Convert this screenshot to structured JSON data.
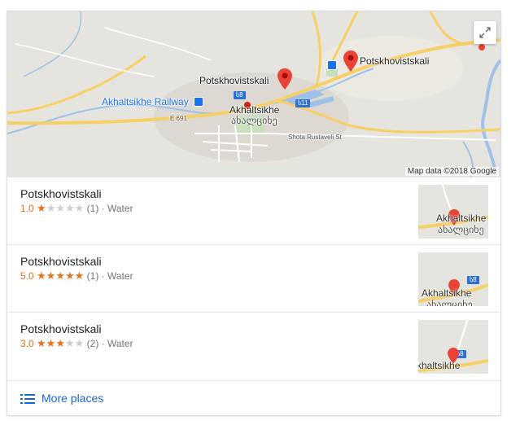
{
  "map": {
    "labels": {
      "pin1": "Potskhovistskali",
      "pin2": "Potskhovistskali",
      "railway": "Akhaltsikhe Railway",
      "town": "Akhaltsikhe",
      "town_script": "ახალციხე",
      "road_e691": "E 691",
      "road_shota": "Shota Rustaveli St",
      "shield_8": "ს8",
      "shield_11": "ს11"
    },
    "attribution": "Map data ©2018 Google",
    "expand_icon": "expand-icon"
  },
  "results": [
    {
      "name": "Potskhovistskali",
      "rating": "1.0",
      "stars_filled": 1,
      "reviews": "(1)",
      "category": "· Water",
      "thumb_labels": [
        "Akhaltsikhe",
        "ახალციხე"
      ]
    },
    {
      "name": "Potskhovistskali",
      "rating": "5.0",
      "stars_filled": 5,
      "reviews": "(1)",
      "category": "· Water",
      "thumb_labels": [
        "Akhaltsikhe",
        "ახალციხე"
      ],
      "thumb_shield": "ს8"
    },
    {
      "name": "Potskhovistskali",
      "rating": "3.0",
      "stars_filled": 3,
      "reviews": "(2)",
      "category": "· Water",
      "thumb_labels": [
        "khaltsikhe"
      ],
      "thumb_shield": "ს8"
    }
  ],
  "more": {
    "label": "More places",
    "icon": "list-icon"
  },
  "colors": {
    "star": "#e7711b",
    "link": "#1967d2",
    "pin": "#ea4335",
    "road": "#f6cf65",
    "water": "#9ec1e8"
  }
}
